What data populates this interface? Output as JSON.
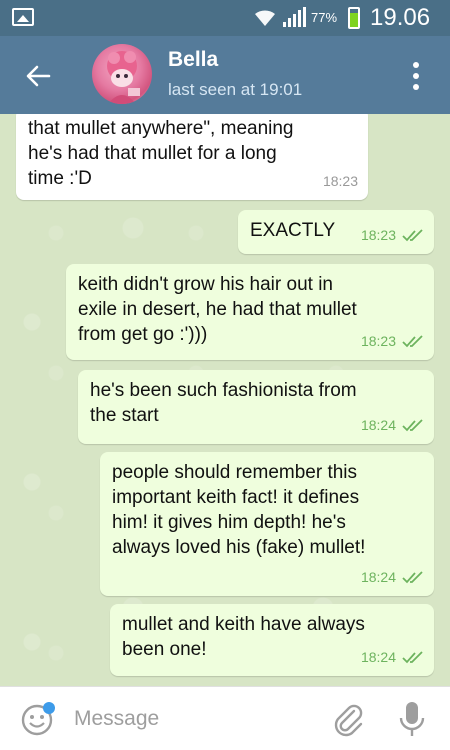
{
  "status_bar": {
    "battery": "77%",
    "time": "19.06",
    "battery_level": 0.77
  },
  "header": {
    "name": "Bella",
    "status": "last seen at 19:01"
  },
  "messages": [
    {
      "direction": "in",
      "text": "that mullet anywhere\", meaning\nhe's had that mullet for a long\ntime :'D",
      "time": "18:23"
    },
    {
      "direction": "out",
      "text": "EXACTLY",
      "time": "18:23"
    },
    {
      "direction": "out",
      "text": "keith didn't grow his hair out in\nexile in desert, he had that mullet\nfrom get go :')))",
      "time": "18:23"
    },
    {
      "direction": "out",
      "text": "he's been such fashionista from\nthe start",
      "time": "18:24"
    },
    {
      "direction": "out",
      "text": "people should remember this\nimportant keith fact! it defines\nhim! it gives him depth! he's\nalways loved his (fake) mullet!",
      "time": "18:24"
    },
    {
      "direction": "out",
      "text": "mullet and keith have always\nbeen one!",
      "time": "18:24"
    }
  ],
  "input": {
    "placeholder": "Message"
  },
  "icons": {
    "back": "back-arrow-icon",
    "more": "more-vertical-icon",
    "emoji": "emoji-icon",
    "attach": "paperclip-icon",
    "mic": "microphone-icon",
    "read": "double-check-icon"
  },
  "colors": {
    "header": "#557b9a",
    "statusbar": "#4a6f87",
    "bubble_out": "#effedd",
    "bubble_in": "#ffffff",
    "check": "#6db35e"
  }
}
